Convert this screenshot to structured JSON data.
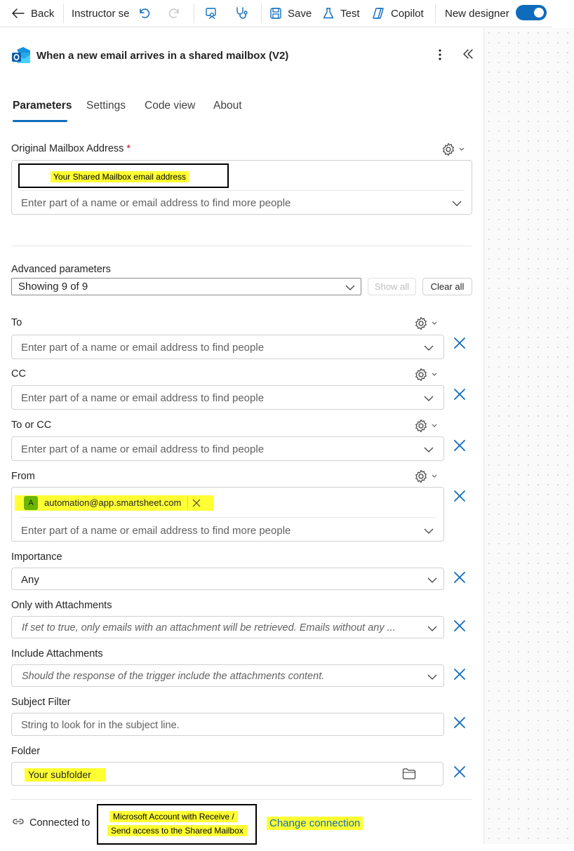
{
  "toolbar": {
    "back": "Back",
    "instructor": "Instructor se",
    "save": "Save",
    "test": "Test",
    "copilot": "Copilot",
    "new_designer": "New designer",
    "new_designer_on": true
  },
  "panel": {
    "title": "When a new email arrives in a shared mailbox (V2)",
    "tabs": [
      "Parameters",
      "Settings",
      "Code view",
      "About"
    ],
    "active_tab": "Parameters"
  },
  "mailbox": {
    "label": "Original Mailbox Address",
    "required_mark": "*",
    "annotation": "Your Shared Mailbox email address",
    "placeholder": "Enter part of a name or email address to find more people"
  },
  "advanced": {
    "label": "Advanced parameters",
    "showing": "Showing 9 of 9",
    "show_all": "Show all",
    "clear_all": "Clear all"
  },
  "fields": {
    "to": {
      "label": "To",
      "placeholder": "Enter part of a name or email address to find people"
    },
    "cc": {
      "label": "CC",
      "placeholder": "Enter part of a name or email address to find people"
    },
    "to_or_cc": {
      "label": "To or CC",
      "placeholder": "Enter part of a name or email address to find people"
    },
    "from": {
      "label": "From",
      "chip_initial": "A",
      "chip_email": "automation@app.smartsheet.com",
      "placeholder": "Enter part of a name or email address to find more people"
    },
    "importance": {
      "label": "Importance",
      "value": "Any"
    },
    "only_attachments": {
      "label": "Only with Attachments",
      "placeholder": "If set to true, only emails with an attachment will be retrieved. Emails without any ..."
    },
    "include_attachments": {
      "label": "Include Attachments",
      "placeholder": "Should the response of the trigger include the attachments content."
    },
    "subject_filter": {
      "label": "Subject Filter",
      "placeholder": "String to look for in the subject line."
    },
    "folder": {
      "label": "Folder",
      "value": "Your subfolder"
    }
  },
  "connection": {
    "connected_to": "Connected to",
    "annotation_line1": "Microsoft Account with Receive /",
    "annotation_line2": "Send access to the Shared Mailbox",
    "change": "Change connection"
  },
  "colors": {
    "accent": "#0f6cbd",
    "highlight": "#ffff33",
    "required": "#c50f1f"
  }
}
